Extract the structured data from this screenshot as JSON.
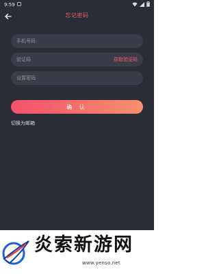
{
  "status_bar": {
    "time": "9:59",
    "wifi_icon": "wifi-icon",
    "signal_icon": "signal-icon",
    "battery_icon": "battery-icon"
  },
  "header": {
    "back_icon": "arrow-left-icon",
    "title": "忘记密码"
  },
  "form": {
    "phone_placeholder": "手机号码",
    "code_placeholder": "验证码",
    "get_code_label": "获取验证码",
    "password_placeholder": "设置密码",
    "confirm_label": "确 认",
    "switch_label": "切换为邮箱"
  },
  "watermark": {
    "site_name": "炎索新游网",
    "url": "www.yenso.net"
  },
  "colors": {
    "background": "#2b2d36",
    "field_bg": "#3a3d47",
    "accent": "#f05a6e",
    "button_gradient_start": "#f2506b",
    "button_gradient_end": "#f7906f"
  }
}
